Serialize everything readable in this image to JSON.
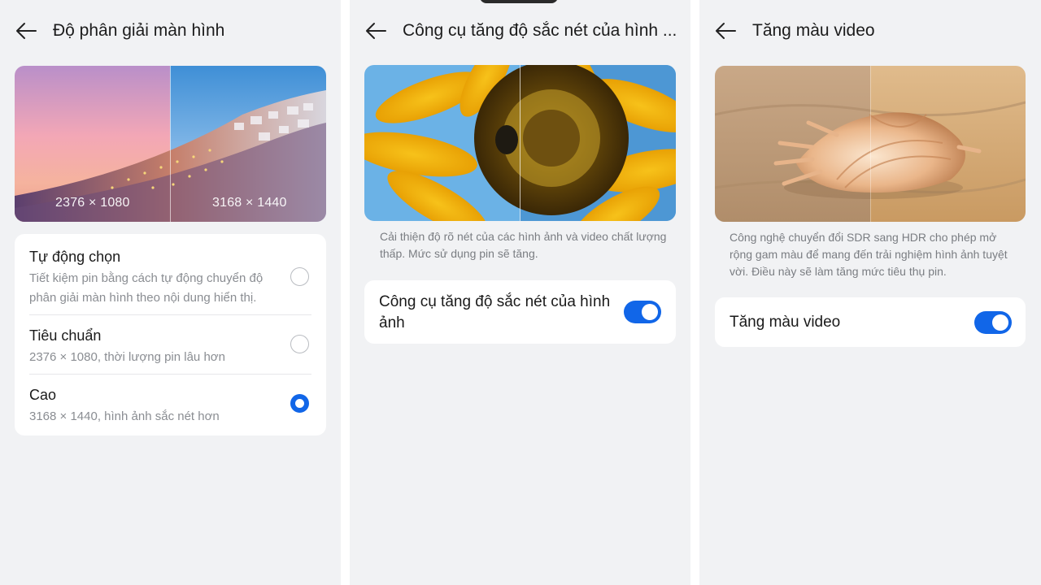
{
  "panel1": {
    "title": "Độ phân giải màn hình",
    "hero_labels": {
      "left": "2376 × 1080",
      "right": "3168 × 1440"
    },
    "options": [
      {
        "title": "Tự động chọn",
        "subtitle": "Tiết kiệm pin bằng cách tự động chuyển độ phân giải màn hình theo nội dung hiển thị.",
        "selected": false
      },
      {
        "title": "Tiêu chuẩn",
        "subtitle": "2376 × 1080, thời lượng pin lâu hơn",
        "selected": false
      },
      {
        "title": "Cao",
        "subtitle": "3168 × 1440, hình ảnh sắc nét hơn",
        "selected": true
      }
    ]
  },
  "panel2": {
    "title": "Công cụ tăng độ sắc nét của hình ...",
    "description": "Cải thiện độ rõ nét của các hình ảnh và video chất lượng thấp. Mức sử dụng pin sẽ tăng.",
    "toggle_label": "Công cụ tăng độ sắc nét của hình ảnh",
    "toggle_on": true
  },
  "panel3": {
    "title": "Tăng màu video",
    "description": "Công nghệ chuyển đổi SDR sang HDR cho phép mở rộng gam màu để mang đến trải nghiệm hình ảnh tuyệt vời. Điều này sẽ làm tăng mức tiêu thụ pin.",
    "toggle_label": "Tăng màu video",
    "toggle_on": true
  },
  "colors": {
    "accent": "#1166e8",
    "background": "#f1f2f4",
    "card": "#ffffff"
  },
  "icons": {
    "back": "arrow-left-icon",
    "radio": "radio-button-icon"
  }
}
